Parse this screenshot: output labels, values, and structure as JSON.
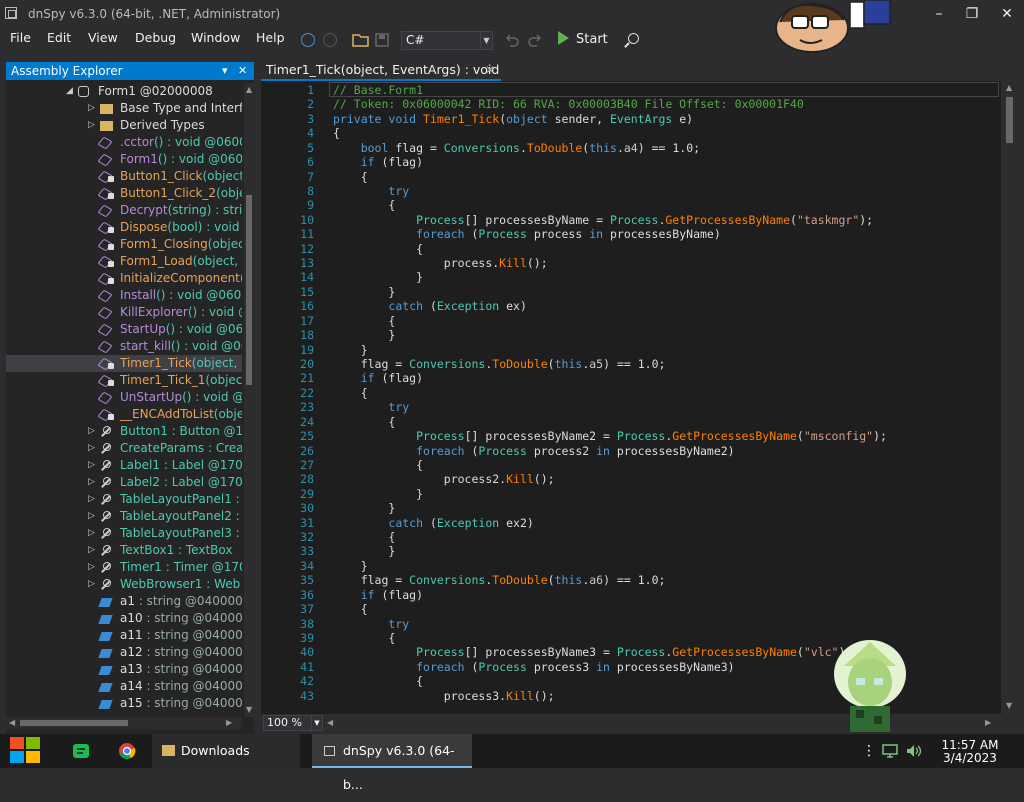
{
  "window": {
    "title": "dnSpy v6.3.0 (64-bit, .NET, Administrator)",
    "minimize": "–",
    "maximize": "❐",
    "close": "✕"
  },
  "menu": [
    "File",
    "Edit",
    "View",
    "Debug",
    "Window",
    "Help"
  ],
  "toolbar": {
    "language": "C#",
    "start_label": "Start"
  },
  "explorer": {
    "title": "Assembly Explorer",
    "pin": "▾",
    "close": "✕",
    "items": [
      {
        "arrow": "◢",
        "icon": "class",
        "label": "Form1",
        "suffix": " @02000008",
        "color": "white",
        "indent": 0
      },
      {
        "arrow": "▷",
        "icon": "folder",
        "label": "Base Type and Interf",
        "suffix": "",
        "color": "white",
        "indent": 1
      },
      {
        "arrow": "▷",
        "icon": "folder",
        "label": "Derived Types",
        "suffix": "",
        "color": "white",
        "indent": 1
      },
      {
        "arrow": "",
        "icon": "method",
        "label": ".cctor",
        "suffix": "() : void @0600",
        "color": "purple",
        "indent": 1
      },
      {
        "arrow": "",
        "icon": "method",
        "label": "Form1",
        "suffix": "() : void @060",
        "color": "purple",
        "indent": 1
      },
      {
        "arrow": "",
        "icon": "method",
        "label": "Button1_Click",
        "suffix": "(object,",
        "color": "orange",
        "indent": 1,
        "lock": true
      },
      {
        "arrow": "",
        "icon": "method",
        "label": "Button1_Click_2",
        "suffix": "(obje",
        "color": "orange",
        "indent": 1,
        "lock": true
      },
      {
        "arrow": "",
        "icon": "method",
        "label": "Decrypt",
        "suffix": "(string) : strin",
        "color": "purple",
        "indent": 1
      },
      {
        "arrow": "",
        "icon": "method",
        "label": "Dispose",
        "suffix": "(bool) : void",
        "color": "orange",
        "indent": 1,
        "lock": true
      },
      {
        "arrow": "",
        "icon": "method",
        "label": "Form1_Closing",
        "suffix": "(object",
        "color": "orange",
        "indent": 1,
        "lock": true
      },
      {
        "arrow": "",
        "icon": "method",
        "label": "Form1_Load",
        "suffix": "(object, E",
        "color": "orange",
        "indent": 1,
        "lock": true
      },
      {
        "arrow": "",
        "icon": "method",
        "label": "InitializeComponent",
        "suffix": "()",
        "color": "orange",
        "indent": 1,
        "lock": true
      },
      {
        "arrow": "",
        "icon": "method",
        "label": "Install",
        "suffix": "() : void @0600",
        "color": "purple",
        "indent": 1
      },
      {
        "arrow": "",
        "icon": "method",
        "label": "KillExplorer",
        "suffix": "() : void @",
        "color": "purple",
        "indent": 1
      },
      {
        "arrow": "",
        "icon": "method",
        "label": "StartUp",
        "suffix": "() : void @06",
        "color": "purple",
        "indent": 1
      },
      {
        "arrow": "",
        "icon": "method",
        "label": "start_kill",
        "suffix": "() : void @06",
        "color": "purple",
        "indent": 1
      },
      {
        "arrow": "",
        "icon": "method",
        "label": "Timer1_Tick",
        "suffix": "(object, E",
        "color": "orange",
        "indent": 1,
        "lock": true,
        "selected": true
      },
      {
        "arrow": "",
        "icon": "method",
        "label": "Timer1_Tick_1",
        "suffix": "(object",
        "color": "orange",
        "indent": 1,
        "lock": true
      },
      {
        "arrow": "",
        "icon": "method",
        "label": "UnStartUp",
        "suffix": "() : void @",
        "color": "purple",
        "indent": 1
      },
      {
        "arrow": "",
        "icon": "method",
        "label": "__ENCAddToList",
        "suffix": "(obje",
        "color": "orange",
        "indent": 1,
        "lock": true
      },
      {
        "arrow": "▷",
        "icon": "wrench",
        "label": "Button1",
        "suffix": " : Button @17",
        "color": "teal",
        "indent": 1
      },
      {
        "arrow": "▷",
        "icon": "wrench",
        "label": "CreateParams",
        "suffix": " : Crea",
        "color": "teal",
        "indent": 1
      },
      {
        "arrow": "▷",
        "icon": "wrench",
        "label": "Label1",
        "suffix": " : Label @170",
        "color": "teal",
        "indent": 1
      },
      {
        "arrow": "▷",
        "icon": "wrench",
        "label": "Label2",
        "suffix": " : Label @170",
        "color": "teal",
        "indent": 1
      },
      {
        "arrow": "▷",
        "icon": "wrench",
        "label": "TableLayoutPanel1",
        "suffix": " :",
        "color": "teal",
        "indent": 1
      },
      {
        "arrow": "▷",
        "icon": "wrench",
        "label": "TableLayoutPanel2",
        "suffix": " :",
        "color": "teal",
        "indent": 1
      },
      {
        "arrow": "▷",
        "icon": "wrench",
        "label": "TableLayoutPanel3",
        "suffix": " :",
        "color": "teal",
        "indent": 1
      },
      {
        "arrow": "▷",
        "icon": "wrench",
        "label": "TextBox1",
        "suffix": " : TextBox",
        "color": "teal",
        "indent": 1
      },
      {
        "arrow": "▷",
        "icon": "wrench",
        "label": "Timer1",
        "suffix": " : Timer @170",
        "color": "teal",
        "indent": 1
      },
      {
        "arrow": "▷",
        "icon": "wrench",
        "label": "WebBrowser1",
        "suffix": " : Web",
        "color": "teal",
        "indent": 1
      },
      {
        "arrow": "",
        "icon": "field",
        "label": "a1",
        "suffix": " : string @040000",
        "color": "white",
        "indent": 1
      },
      {
        "arrow": "",
        "icon": "field",
        "label": "a10",
        "suffix": " : string @04000",
        "color": "white",
        "indent": 1
      },
      {
        "arrow": "",
        "icon": "field",
        "label": "a11",
        "suffix": " : string @04000",
        "color": "white",
        "indent": 1
      },
      {
        "arrow": "",
        "icon": "field",
        "label": "a12",
        "suffix": " : string @04000",
        "color": "white",
        "indent": 1
      },
      {
        "arrow": "",
        "icon": "field",
        "label": "a13",
        "suffix": " : string @04000",
        "color": "white",
        "indent": 1
      },
      {
        "arrow": "",
        "icon": "field",
        "label": "a14",
        "suffix": " : string @04000",
        "color": "white",
        "indent": 1
      },
      {
        "arrow": "",
        "icon": "field",
        "label": "a15",
        "suffix": " : string @04000",
        "color": "white",
        "indent": 1
      }
    ]
  },
  "editor": {
    "tab_label": "Timer1_Tick(object, EventArgs) : void",
    "tab_close": "✕",
    "zoom": "100 %",
    "lines": [
      [
        [
          "cm",
          "// Base.Form1"
        ]
      ],
      [
        [
          "cm",
          "// Token: 0x06000042 RID: 66 RVA: 0x00003B40 File Offset: 0x00001F40"
        ]
      ],
      [
        [
          "kw",
          "private "
        ],
        [
          "kw",
          "void "
        ],
        [
          "mt",
          "Timer1_Tick"
        ],
        [
          "pl",
          "("
        ],
        [
          "kw",
          "object "
        ],
        [
          "pl",
          "sender, "
        ],
        [
          "ty",
          "EventArgs "
        ],
        [
          "pl",
          "e)"
        ]
      ],
      [
        [
          "pl",
          "{"
        ]
      ],
      [
        [
          "pl",
          "    "
        ],
        [
          "kw",
          "bool "
        ],
        [
          "pl",
          "flag = "
        ],
        [
          "ty",
          "Conversions"
        ],
        [
          "pl",
          "."
        ],
        [
          "mt",
          "ToDouble"
        ],
        [
          "pl",
          "("
        ],
        [
          "kw",
          "this"
        ],
        [
          "pl",
          "."
        ],
        [
          "pr",
          "a4"
        ],
        [
          "pl",
          ") == 1.0;"
        ]
      ],
      [
        [
          "pl",
          "    "
        ],
        [
          "kw",
          "if "
        ],
        [
          "pl",
          "(flag)"
        ]
      ],
      [
        [
          "pl",
          "    {"
        ]
      ],
      [
        [
          "pl",
          "        "
        ],
        [
          "kw",
          "try"
        ]
      ],
      [
        [
          "pl",
          "        {"
        ]
      ],
      [
        [
          "pl",
          "            "
        ],
        [
          "ty",
          "Process"
        ],
        [
          "pl",
          "[] processesByName = "
        ],
        [
          "ty",
          "Process"
        ],
        [
          "pl",
          "."
        ],
        [
          "mt",
          "GetProcessesByName"
        ],
        [
          "pl",
          "("
        ],
        [
          "st",
          "\"taskmgr\""
        ],
        [
          "pl",
          ");"
        ]
      ],
      [
        [
          "pl",
          "            "
        ],
        [
          "kw",
          "foreach "
        ],
        [
          "pl",
          "("
        ],
        [
          "ty",
          "Process "
        ],
        [
          "pl",
          "process "
        ],
        [
          "kw",
          "in "
        ],
        [
          "pl",
          "processesByName)"
        ]
      ],
      [
        [
          "pl",
          "            {"
        ]
      ],
      [
        [
          "pl",
          "                process."
        ],
        [
          "mt",
          "Kill"
        ],
        [
          "pl",
          "();"
        ]
      ],
      [
        [
          "pl",
          "            }"
        ]
      ],
      [
        [
          "pl",
          "        }"
        ]
      ],
      [
        [
          "pl",
          "        "
        ],
        [
          "kw",
          "catch "
        ],
        [
          "pl",
          "("
        ],
        [
          "ty",
          "Exception "
        ],
        [
          "pl",
          "ex)"
        ]
      ],
      [
        [
          "pl",
          "        {"
        ]
      ],
      [
        [
          "pl",
          "        }"
        ]
      ],
      [
        [
          "pl",
          "    }"
        ]
      ],
      [
        [
          "pl",
          "    flag = "
        ],
        [
          "ty",
          "Conversions"
        ],
        [
          "pl",
          "."
        ],
        [
          "mt",
          "ToDouble"
        ],
        [
          "pl",
          "("
        ],
        [
          "kw",
          "this"
        ],
        [
          "pl",
          "."
        ],
        [
          "pr",
          "a5"
        ],
        [
          "pl",
          ") == 1.0;"
        ]
      ],
      [
        [
          "pl",
          "    "
        ],
        [
          "kw",
          "if "
        ],
        [
          "pl",
          "(flag)"
        ]
      ],
      [
        [
          "pl",
          "    {"
        ]
      ],
      [
        [
          "pl",
          "        "
        ],
        [
          "kw",
          "try"
        ]
      ],
      [
        [
          "pl",
          "        {"
        ]
      ],
      [
        [
          "pl",
          "            "
        ],
        [
          "ty",
          "Process"
        ],
        [
          "pl",
          "[] processesByName2 = "
        ],
        [
          "ty",
          "Process"
        ],
        [
          "pl",
          "."
        ],
        [
          "mt",
          "GetProcessesByName"
        ],
        [
          "pl",
          "("
        ],
        [
          "st",
          "\"msconfig\""
        ],
        [
          "pl",
          ");"
        ]
      ],
      [
        [
          "pl",
          "            "
        ],
        [
          "kw",
          "foreach "
        ],
        [
          "pl",
          "("
        ],
        [
          "ty",
          "Process "
        ],
        [
          "pl",
          "process2 "
        ],
        [
          "kw",
          "in "
        ],
        [
          "pl",
          "processesByName2)"
        ]
      ],
      [
        [
          "pl",
          "            {"
        ]
      ],
      [
        [
          "pl",
          "                process2."
        ],
        [
          "mt",
          "Kill"
        ],
        [
          "pl",
          "();"
        ]
      ],
      [
        [
          "pl",
          "            }"
        ]
      ],
      [
        [
          "pl",
          "        }"
        ]
      ],
      [
        [
          "pl",
          "        "
        ],
        [
          "kw",
          "catch "
        ],
        [
          "pl",
          "("
        ],
        [
          "ty",
          "Exception "
        ],
        [
          "pl",
          "ex2)"
        ]
      ],
      [
        [
          "pl",
          "        {"
        ]
      ],
      [
        [
          "pl",
          "        }"
        ]
      ],
      [
        [
          "pl",
          "    }"
        ]
      ],
      [
        [
          "pl",
          "    flag = "
        ],
        [
          "ty",
          "Conversions"
        ],
        [
          "pl",
          "."
        ],
        [
          "mt",
          "ToDouble"
        ],
        [
          "pl",
          "("
        ],
        [
          "kw",
          "this"
        ],
        [
          "pl",
          "."
        ],
        [
          "pr",
          "a6"
        ],
        [
          "pl",
          ") == 1.0;"
        ]
      ],
      [
        [
          "pl",
          "    "
        ],
        [
          "kw",
          "if "
        ],
        [
          "pl",
          "(flag)"
        ]
      ],
      [
        [
          "pl",
          "    {"
        ]
      ],
      [
        [
          "pl",
          "        "
        ],
        [
          "kw",
          "try"
        ]
      ],
      [
        [
          "pl",
          "        {"
        ]
      ],
      [
        [
          "pl",
          "            "
        ],
        [
          "ty",
          "Process"
        ],
        [
          "pl",
          "[] processesByName3 = "
        ],
        [
          "ty",
          "Process"
        ],
        [
          "pl",
          "."
        ],
        [
          "mt",
          "GetProcessesByName"
        ],
        [
          "pl",
          "("
        ],
        [
          "st",
          "\"vlc\""
        ],
        [
          "pl",
          ");"
        ]
      ],
      [
        [
          "pl",
          "            "
        ],
        [
          "kw",
          "foreach "
        ],
        [
          "pl",
          "("
        ],
        [
          "ty",
          "Process "
        ],
        [
          "pl",
          "process3 "
        ],
        [
          "kw",
          "in "
        ],
        [
          "pl",
          "processesByName3)"
        ]
      ],
      [
        [
          "pl",
          "            {"
        ]
      ],
      [
        [
          "pl",
          "                process3."
        ],
        [
          "mt",
          "Kill"
        ],
        [
          "pl",
          "();"
        ]
      ]
    ]
  },
  "taskbar": {
    "items": [
      {
        "name": "taskbar-downloads",
        "label": "Downloads"
      },
      {
        "name": "taskbar-dnspy",
        "label": "dnSpy v6.3.0 (64-b..."
      }
    ],
    "time": "11:57 AM",
    "date": "3/4/2023"
  },
  "colors": {
    "accent": "#007acc",
    "background": "#1e1e1e"
  }
}
